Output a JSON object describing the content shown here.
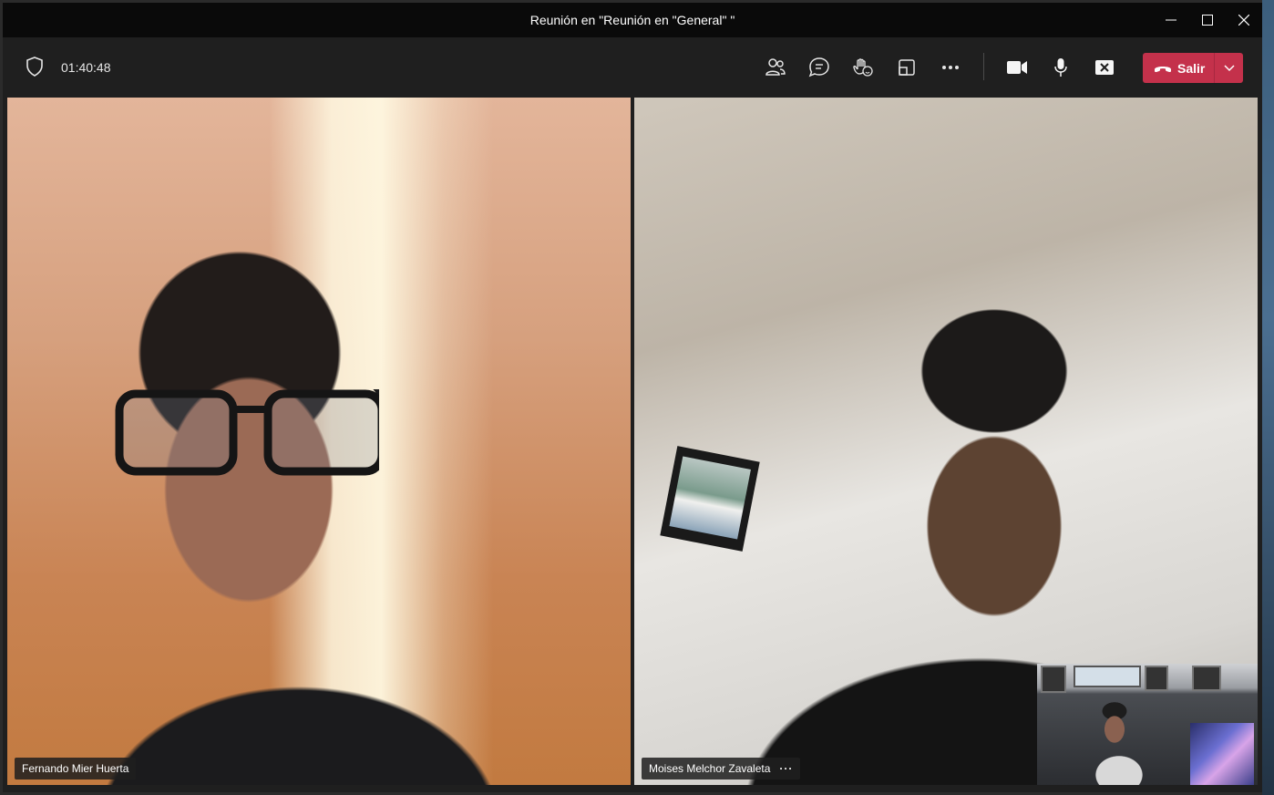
{
  "window": {
    "title": "Reunión en \"Reunión en \"General\" \"",
    "controls": [
      "minimize",
      "maximize",
      "close"
    ]
  },
  "toolbar": {
    "timer": "01:40:48",
    "icons": {
      "security": "shield-icon",
      "participants": "people-icon",
      "chat": "chat-icon",
      "reactions": "reactions-icon",
      "share_tray": "share-screen-icon",
      "more": "more-icon",
      "camera": "camera-icon",
      "mic": "microphone-icon",
      "share": "share-content-icon"
    },
    "leave_label": "Salir",
    "leave_color": "#c4314b"
  },
  "participants": [
    {
      "name": "Fernando Mier Huerta"
    },
    {
      "name": "Moises Melchor Zavaleta",
      "more": "···"
    }
  ]
}
